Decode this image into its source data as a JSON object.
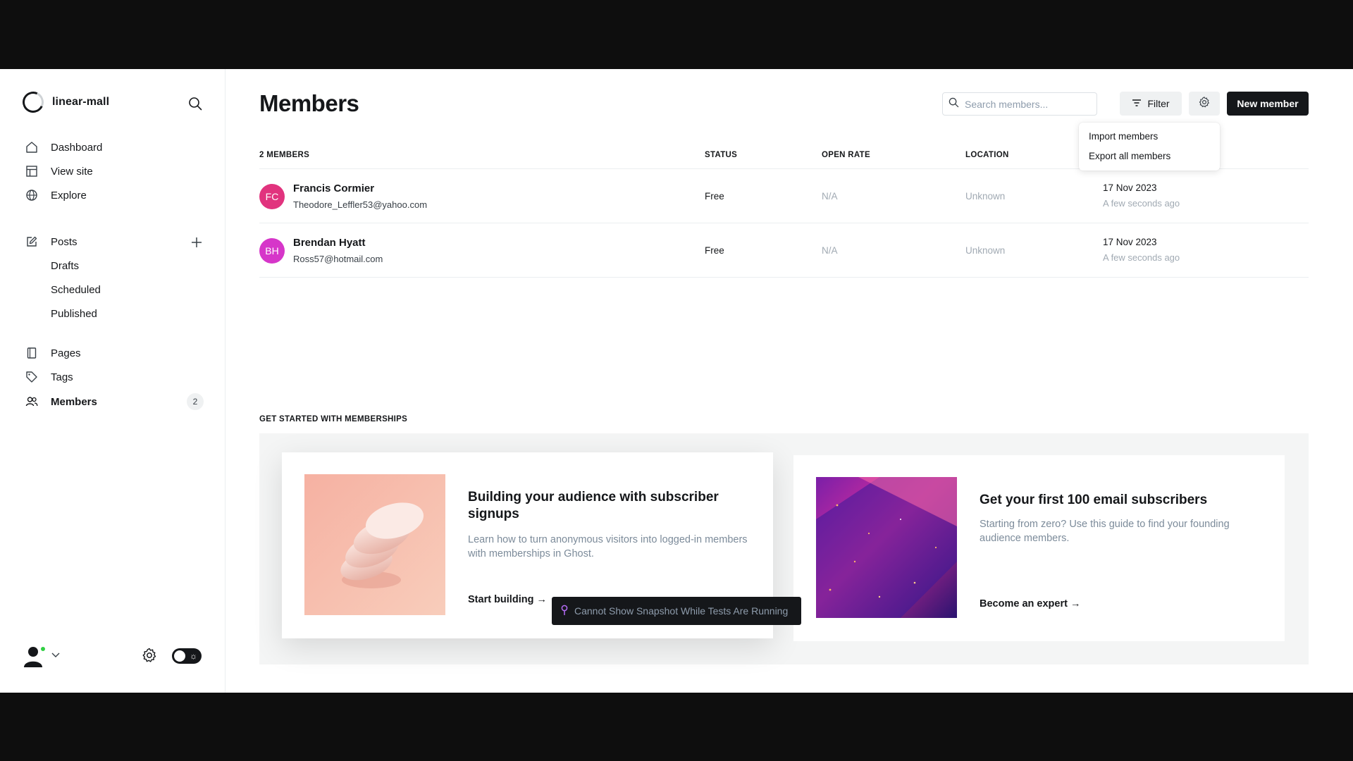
{
  "site": {
    "name": "linear-mall"
  },
  "nav": {
    "dashboard": "Dashboard",
    "view_site": "View site",
    "explore": "Explore",
    "posts": "Posts",
    "drafts": "Drafts",
    "scheduled": "Scheduled",
    "published": "Published",
    "pages": "Pages",
    "tags": "Tags",
    "members": "Members",
    "members_count": "2"
  },
  "header": {
    "title": "Members",
    "search_placeholder": "Search members...",
    "filter_label": "Filter",
    "new_member_label": "New member"
  },
  "dropdown": {
    "import": "Import members",
    "export": "Export all members"
  },
  "table": {
    "headers": {
      "members": "2 MEMBERS",
      "status": "STATUS",
      "open_rate": "OPEN RATE",
      "location": "LOCATION"
    },
    "rows": [
      {
        "initials": "FC",
        "avatar_color": "#e1337e",
        "name": "Francis Cormier",
        "email": "Theodore_Leffler53@yahoo.com",
        "status": "Free",
        "open_rate": "N/A",
        "location": "Unknown",
        "date": "17 Nov 2023",
        "ago": "A few seconds ago"
      },
      {
        "initials": "BH",
        "avatar_color": "#d636c9",
        "name": "Brendan Hyatt",
        "email": "Ross57@hotmail.com",
        "status": "Free",
        "open_rate": "N/A",
        "location": "Unknown",
        "date": "17 Nov 2023",
        "ago": "A few seconds ago"
      }
    ]
  },
  "get_started": {
    "title": "GET STARTED WITH MEMBERSHIPS",
    "cards": [
      {
        "title": "Building your audience with subscriber signups",
        "desc": "Learn how to turn anonymous visitors into logged-in members with memberships in Ghost.",
        "link": "Start building →"
      },
      {
        "title": "Get your first 100 email subscribers",
        "desc": "Starting from zero? Use this guide to find your founding audience members.",
        "link": "Become an expert →"
      }
    ]
  },
  "tooltip": {
    "text": "Cannot Show Snapshot While Tests Are Running"
  },
  "colors": {
    "accent": "#15171a",
    "presence": "#30cf43",
    "muted": "#a1aab3"
  }
}
